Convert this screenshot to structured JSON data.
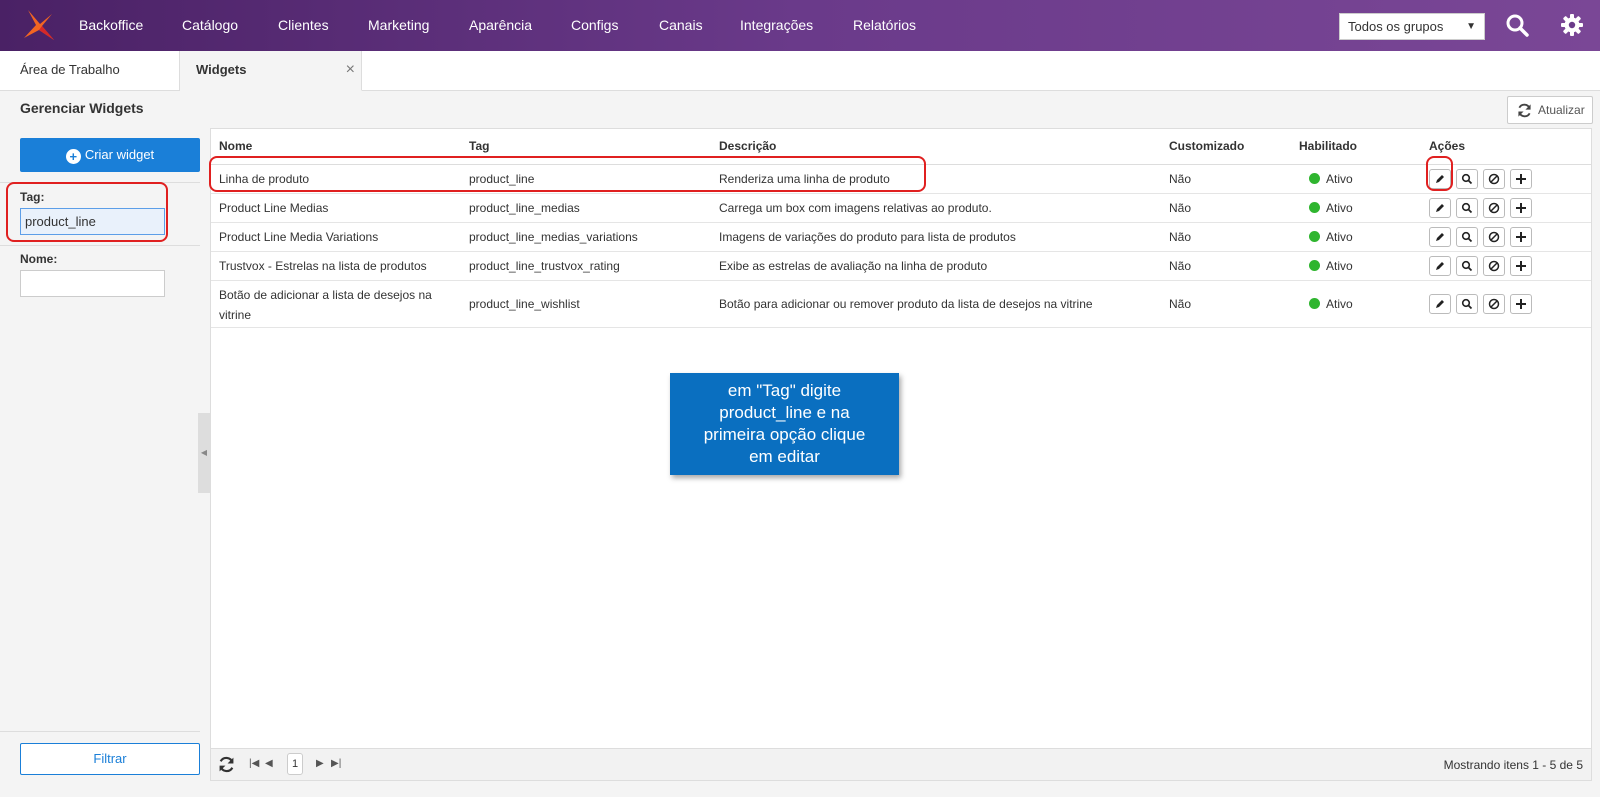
{
  "topbar": {
    "nav": [
      "Backoffice",
      "Catálogo",
      "Clientes",
      "Marketing",
      "Aparência",
      "Configs",
      "Canais",
      "Integrações",
      "Relatórios"
    ],
    "group_select": "Todos os grupos",
    "brand_colors": {
      "bar_start": "#4a2165",
      "bar_end": "#7a4796",
      "logo_orange": "#f26522",
      "logo_red": "#d62828"
    }
  },
  "tabs": [
    {
      "label": "Área de Trabalho"
    },
    {
      "label": "Widgets",
      "close": "×"
    }
  ],
  "page": {
    "title": "Gerenciar Widgets",
    "refresh_label": "Atualizar"
  },
  "sidebar": {
    "create_label": "Criar widget",
    "tag_label": "Tag:",
    "tag_value": "product_line",
    "name_label": "Nome:",
    "name_value": "",
    "filter_label": "Filtrar"
  },
  "grid": {
    "columns": [
      "Nome",
      "Tag",
      "Descrição",
      "Customizado",
      "Habilitado",
      "Ações"
    ],
    "rows": [
      {
        "nome": "Linha de produto",
        "tag": "product_line",
        "descricao": "Renderiza uma linha de produto",
        "customizado": "Não",
        "habilitado": "Ativo"
      },
      {
        "nome": "Product Line Medias",
        "tag": "product_line_medias",
        "descricao": "Carrega um box com imagens relativas ao produto.",
        "customizado": "Não",
        "habilitado": "Ativo"
      },
      {
        "nome": "Product Line Media Variations",
        "tag": "product_line_medias_variations",
        "descricao": "Imagens de variações do produto para lista de produtos",
        "customizado": "Não",
        "habilitado": "Ativo"
      },
      {
        "nome": "Trustvox - Estrelas na lista de produtos",
        "tag": "product_line_trustvox_rating",
        "descricao": "Exibe as estrelas de avaliação na linha de produto",
        "customizado": "Não",
        "habilitado": "Ativo"
      },
      {
        "nome_line1": "Botão de adicionar a lista de desejos na",
        "nome_line2": "vitrine",
        "tag": "product_line_wishlist",
        "descricao": "Botão para adicionar ou remover produto da lista de desejos na vitrine",
        "customizado": "Não",
        "habilitado": "Ativo"
      }
    ],
    "pager": {
      "page": "1",
      "info": "Mostrando itens 1 - 5 de 5"
    },
    "status_color": "#2fb52f"
  },
  "callout": {
    "lines": [
      "em \"Tag\" digite",
      "product_line e na",
      "primeira opção clique",
      "em editar"
    ],
    "color": "#0a6fc0"
  }
}
